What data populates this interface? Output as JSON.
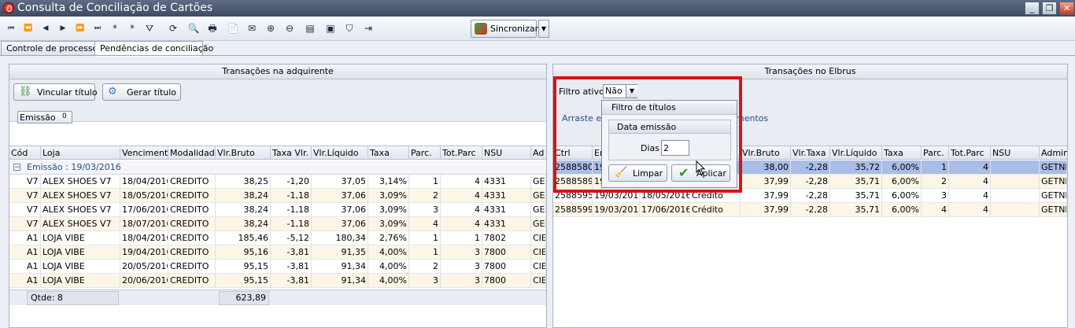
{
  "window": {
    "title": "Consulta de Conciliação de Cartões",
    "controls": [
      "_",
      "❐",
      "✕"
    ]
  },
  "toolbar": {
    "nav_icons": [
      "⏮",
      "⏪",
      "◀",
      "▶",
      "⏩",
      "⏭",
      "*",
      "*",
      "⛛",
      "⟳",
      "🔍",
      "🖶",
      "📄",
      "✉",
      "⊕",
      "⊖",
      "▤",
      "▣",
      "⛉",
      "⇥"
    ],
    "sync_label": "Sincronizar",
    "sync_drop": "▼"
  },
  "tabs": [
    {
      "label": "Controle de processos"
    },
    {
      "label": "Pendências de conciliação"
    }
  ],
  "left_panel": {
    "title": "Transações na adquirente",
    "link_button": "Vincular título",
    "generate_button": "Gerar título",
    "group_chip": "Emissão",
    "group_chip_sort": "0",
    "columns": [
      "Cód",
      "Loja",
      "Vencimento",
      "Modalidade",
      "Vlr.Bruto",
      "Taxa Vlr.",
      "Vlr.Líquido",
      "Taxa",
      "Parc.",
      "Tot.Parc",
      "NSU",
      "Ad"
    ],
    "group_label": "Emissão : 19/03/2016",
    "group_toggle": "−",
    "rows": [
      [
        "V7",
        "ALEX SHOES V7",
        "18/04/2016",
        "CREDITO",
        "38,25",
        "-1,20",
        "37,05",
        "3,14%",
        "1",
        "4",
        "4331",
        "GE"
      ],
      [
        "V7",
        "ALEX SHOES V7",
        "18/05/2016",
        "CREDITO",
        "38,24",
        "-1,18",
        "37,06",
        "3,09%",
        "2",
        "4",
        "4331",
        "GE"
      ],
      [
        "V7",
        "ALEX SHOES V7",
        "17/06/2016",
        "CREDITO",
        "38,24",
        "-1,18",
        "37,06",
        "3,09%",
        "3",
        "4",
        "4331",
        "GE"
      ],
      [
        "V7",
        "ALEX SHOES V7",
        "18/07/2016",
        "CREDITO",
        "38,24",
        "-1,18",
        "37,06",
        "3,09%",
        "4",
        "4",
        "4331",
        "GE"
      ],
      [
        "A1",
        "LOJA VIBE",
        "18/04/2016",
        "CREDITO",
        "185,46",
        "-5,12",
        "180,34",
        "2,76%",
        "1",
        "1",
        "7802",
        "CIE"
      ],
      [
        "A1",
        "LOJA VIBE",
        "19/04/2016",
        "CREDITO",
        "95,16",
        "-3,81",
        "91,35",
        "4,00%",
        "1",
        "3",
        "7800",
        "CIE"
      ],
      [
        "A1",
        "LOJA VIBE",
        "20/05/2016",
        "CREDITO",
        "95,15",
        "-3,81",
        "91,34",
        "4,00%",
        "2",
        "3",
        "7800",
        "CIE"
      ],
      [
        "A1",
        "LOJA VIBE",
        "20/06/2016",
        "CREDITO",
        "95,15",
        "-3,81",
        "91,34",
        "4,00%",
        "3",
        "3",
        "7800",
        "CIE"
      ]
    ],
    "footer_count": "Qtde: 8",
    "footer_total": "623,89"
  },
  "right_panel": {
    "title": "Transações no Elbrus",
    "filter_label": "Filtro ativo",
    "filter_value": "Não",
    "filter_drop": "▼",
    "drag_hint_start": "Arraste e s",
    "drag_hint_end": "mentos",
    "columns": [
      "Ctrl",
      "Em",
      "",
      "",
      "Vlr.Bruto",
      "Vlr.Taxa",
      "Vlr.Líquido",
      "Taxa",
      "Parc.",
      "Tot.Parc",
      "NSU",
      "Admin"
    ],
    "rows": [
      [
        "2588580",
        "19",
        "",
        "",
        "38,00",
        "-2,28",
        "35,72",
        "6,00%",
        "1",
        "4",
        "",
        "GETNE"
      ],
      [
        "2588589",
        "19",
        "",
        "",
        "37,99",
        "-2,28",
        "35,71",
        "6,00%",
        "2",
        "4",
        "",
        "GETNE"
      ],
      [
        "2588595",
        "19/03/2016",
        "18/05/2016",
        "Crédito",
        "37,99",
        "-2,28",
        "35,71",
        "6,00%",
        "3",
        "4",
        "",
        "GETNE"
      ],
      [
        "2588599",
        "19/03/2016",
        "17/06/2016",
        "Crédito",
        "37,99",
        "-2,28",
        "35,71",
        "6,00%",
        "4",
        "4",
        "",
        "GETNE"
      ]
    ]
  },
  "filter_popup": {
    "title": "Filtro de títulos",
    "section": "Data emissão",
    "days_label": "Dias",
    "days_value": "2",
    "clear_button": "Limpar",
    "apply_button": "Aplicar"
  },
  "colors": {
    "highlight": "#d41515",
    "selected_row": "#a9bde6",
    "alt_row": "#fdf6e6"
  }
}
